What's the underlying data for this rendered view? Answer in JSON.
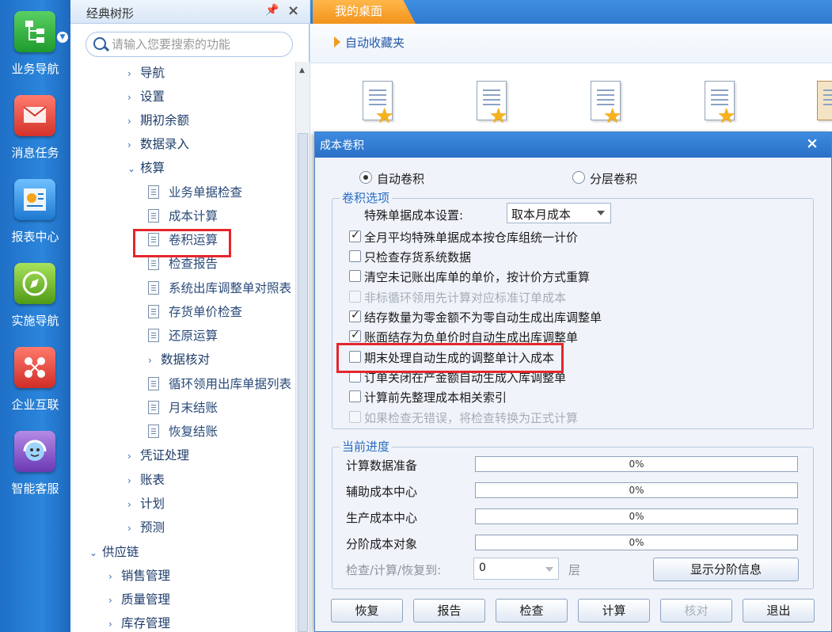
{
  "nav": [
    {
      "label": "业务导航",
      "icon": "org-chart-icon",
      "color": "#2fae3b"
    },
    {
      "label": "消息任务",
      "icon": "envelope-icon",
      "color": "#e8453c"
    },
    {
      "label": "报表中心",
      "icon": "report-icon",
      "color": "#2a8ee0"
    },
    {
      "label": "实施导航",
      "icon": "compass-icon",
      "color": "#7cc12a"
    },
    {
      "label": "企业互联",
      "icon": "network-icon",
      "color": "#e2483f"
    },
    {
      "label": "智能客服",
      "icon": "service-icon",
      "color": "#8b56c9"
    }
  ],
  "tree": {
    "title": "经典树形",
    "search_placeholder": "请输入您要搜索的功能",
    "nodes": [
      {
        "label": "导航",
        "arrow": "›"
      },
      {
        "label": "设置",
        "arrow": "›"
      },
      {
        "label": "期初余额",
        "arrow": "›"
      },
      {
        "label": "数据录入",
        "arrow": "›"
      },
      {
        "label": "核算",
        "arrow": "⌄"
      },
      {
        "label": "业务单据检查"
      },
      {
        "label": "成本计算"
      },
      {
        "label": "卷积运算"
      },
      {
        "label": "检查报告"
      },
      {
        "label": "系统出库调整单对照表"
      },
      {
        "label": "存货单价检查"
      },
      {
        "label": "还原运算"
      },
      {
        "label": "数据核对",
        "arrow": "›"
      },
      {
        "label": "循环领用出库单据列表"
      },
      {
        "label": "月末结账"
      },
      {
        "label": "恢复结账"
      },
      {
        "label": "凭证处理",
        "arrow": "›"
      },
      {
        "label": "账表",
        "arrow": "›"
      },
      {
        "label": "计划",
        "arrow": "›"
      },
      {
        "label": "预测",
        "arrow": "›"
      },
      {
        "label": "供应链",
        "arrow": "⌄"
      },
      {
        "label": "销售管理",
        "arrow": "›"
      },
      {
        "label": "质量管理",
        "arrow": "›"
      },
      {
        "label": "库存管理",
        "arrow": "›"
      }
    ]
  },
  "desk": {
    "tab": "我的桌面",
    "favorites_title": "自动收藏夹"
  },
  "dialog": {
    "title": "成本卷积",
    "radio_auto": "自动卷积",
    "radio_layer": "分层卷积",
    "options_legend": "卷积选项",
    "special_label": "特殊单据成本设置:",
    "special_value": "取本月成本",
    "options": [
      {
        "label": "全月平均特殊单据成本按仓库组统一计价",
        "checked": true,
        "disabled": false
      },
      {
        "label": "只检查存货系统数据",
        "checked": false,
        "disabled": false
      },
      {
        "label": "清空未记账出库单的单价，按计价方式重算",
        "checked": false,
        "disabled": false
      },
      {
        "label": "非标循环领用先计算对应标准订单成本",
        "checked": false,
        "disabled": true
      },
      {
        "label": "结存数量为零金额不为零自动生成出库调整单",
        "checked": true,
        "disabled": false
      },
      {
        "label": "账面结存为负单价时自动生成出库调整单",
        "checked": true,
        "disabled": false
      },
      {
        "label": "期末处理自动生成的调整单计入成本",
        "checked": false,
        "disabled": false
      },
      {
        "label": "订单关闭在产金额自动生成入库调整单",
        "checked": false,
        "disabled": false
      },
      {
        "label": "计算前先整理成本相关索引",
        "checked": false,
        "disabled": false
      },
      {
        "label": "如果检查无错误，将检查转换为正式计算",
        "checked": false,
        "disabled": true
      }
    ],
    "progress_legend": "当前进度",
    "progress": [
      {
        "label": "计算数据准备",
        "value": "0%"
      },
      {
        "label": "辅助成本中心",
        "value": "0%"
      },
      {
        "label": "生产成本中心",
        "value": "0%"
      },
      {
        "label": "分阶成本对象",
        "value": "0%"
      }
    ],
    "depth_label": "检查/计算/恢复到:",
    "depth_value": "0",
    "layer_label": "层",
    "show_info_button": "显示分阶信息",
    "buttons": [
      {
        "label": "恢复",
        "disabled": false
      },
      {
        "label": "报告",
        "disabled": false
      },
      {
        "label": "检查",
        "disabled": false
      },
      {
        "label": "计算",
        "disabled": false
      },
      {
        "label": "核对",
        "disabled": true
      },
      {
        "label": "退出",
        "disabled": false
      }
    ]
  }
}
